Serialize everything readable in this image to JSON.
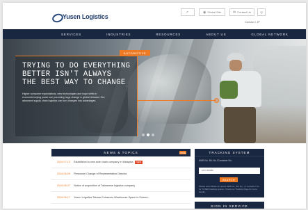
{
  "header": {
    "logo_text": "Yusen Logistics",
    "utilities": {
      "share": "",
      "sitemap": "Global Site",
      "contact": "Contact Us",
      "search": "Q"
    },
    "language": "Contact / JP"
  },
  "nav": {
    "items": [
      {
        "label": "SERVICES"
      },
      {
        "label": "INDUSTRIES"
      },
      {
        "label": "RESOURCES"
      },
      {
        "label": "ABOUT US"
      },
      {
        "label": "GLOBAL NETWORK"
      }
    ]
  },
  "hero": {
    "tag": "AUTOMOTIVE",
    "heading": "TRYING TO DO EVERYTHING\nBETTER ISN'T ALWAYS\nTHE BEST WAY TO CHANGE",
    "body": "Higher consumer expectations, new technologies and huge shifts in economic buying power are provoking huge change in global demand. Our advanced supply chain logistics can turn changes into advantages.",
    "slides": 3,
    "active_slide": 1
  },
  "news": {
    "title": "NEWS & TOPICS",
    "more": "MORE",
    "items": [
      {
        "date": "2016.07.13",
        "text": "Established a new sole chain company in Malaysia",
        "badge": "NEW"
      },
      {
        "date": "2016.06.09",
        "text": "Personnel Change of Representative Director",
        "badge": ""
      },
      {
        "date": "2016.06.07",
        "text": "Notice of acquisition of Taiwanese logistics company",
        "badge": ""
      },
      {
        "date": "2016.06.17",
        "text": "Yusen Logistics Taiwan Enhances Warehouse Space to Extend...",
        "badge": ""
      }
    ]
  },
  "tracking": {
    "title": "TRACKING SYSTEM",
    "label": "AWB No. B/L No./Container No.",
    "placeholder": "sch details",
    "button": "SEARCH",
    "note": "Please enter Master & House AWB No., B/L No., or Container No. for YUSEN tracking system. Check our Tracking Page for more details."
  },
  "sign_in": {
    "title": "SIGN IN SERVICE"
  },
  "colors": {
    "navy": "#1a2740",
    "accent": "#ef7a24"
  }
}
